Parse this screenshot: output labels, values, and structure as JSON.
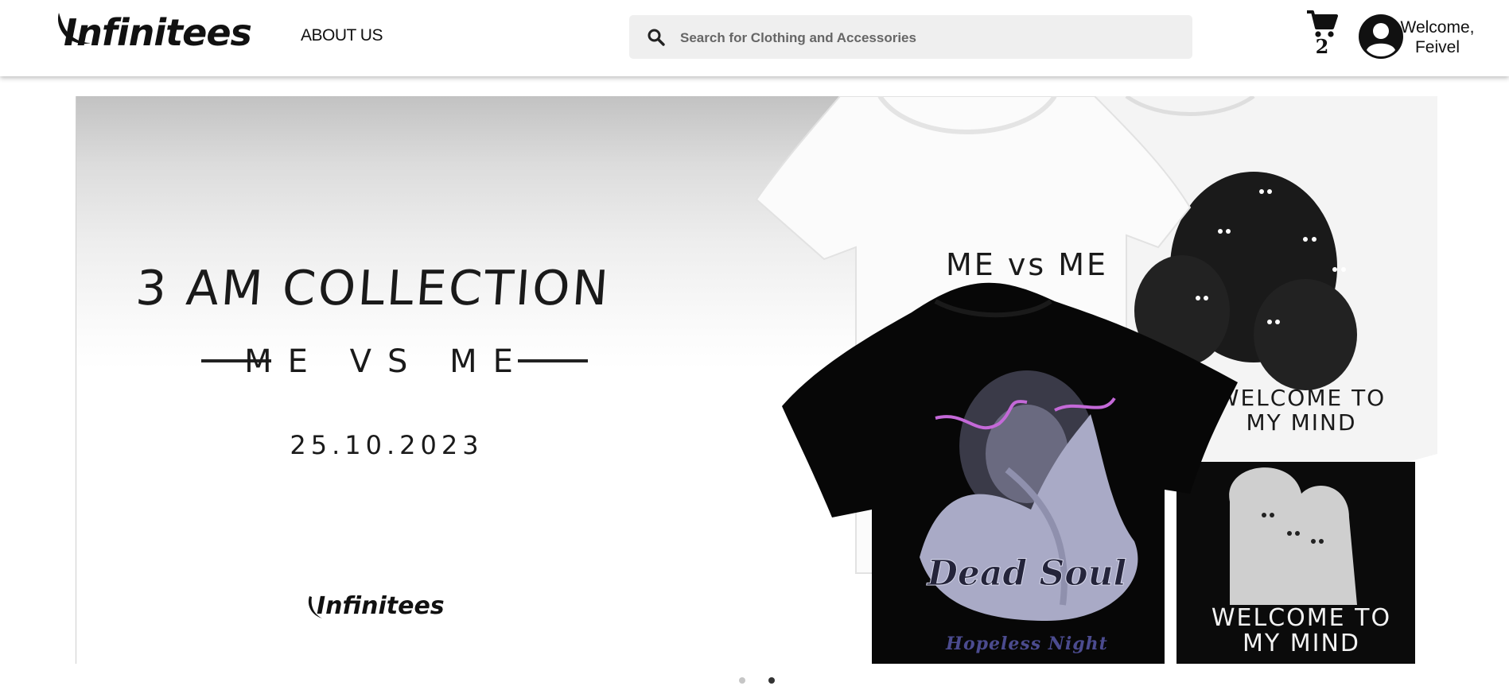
{
  "header": {
    "logo_text": "Infinitees",
    "nav": {
      "about": "ABOUT US"
    },
    "search": {
      "placeholder": "Search for Clothing and Accessories",
      "value": ""
    },
    "cart": {
      "count": "2"
    },
    "user": {
      "welcome_line": "Welcome,",
      "name": "Feivel"
    }
  },
  "banner": {
    "headline": "3 AM COLLECTION",
    "subtitle": "ME VS ME",
    "date": "25.10.2023",
    "brand": "Infinitees",
    "shirts": {
      "front_left_print": "ME vs ME",
      "dead_soul_title": "Dead Soul",
      "dead_soul_sub": "Hopeless Night",
      "back_right_print_1": "WELCOME TO",
      "back_right_print_2": "MY MIND",
      "front_right_print_1": "WELCOME TO",
      "front_right_print_2": "MY MIND"
    }
  },
  "carousel": {
    "slide_count": 2,
    "active_index": 1
  }
}
